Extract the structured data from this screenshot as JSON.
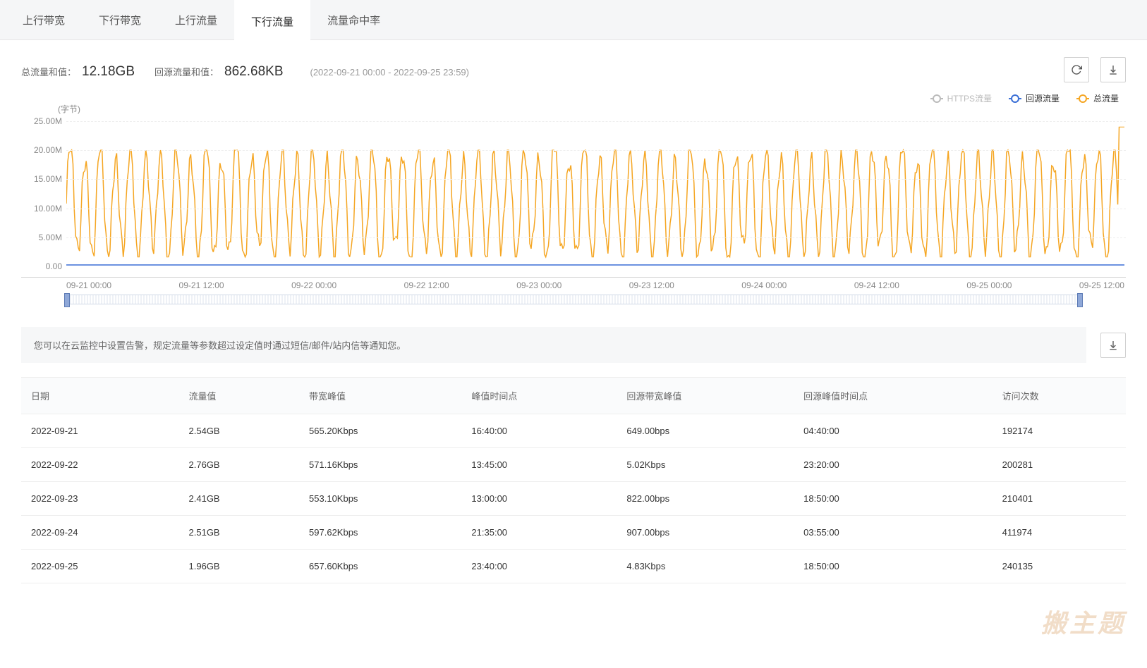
{
  "tabs": [
    "上行带宽",
    "下行带宽",
    "上行流量",
    "下行流量",
    "流量命中率"
  ],
  "active_tab": 3,
  "summary": {
    "total_label": "总流量和值：",
    "total_value": "12.18GB",
    "origin_label": "回源流量和值：",
    "origin_value": "862.68KB",
    "range": "(2022-09-21 00:00 - 2022-09-25 23:59)"
  },
  "legend": {
    "https": "HTTPS流量",
    "origin": "回源流量",
    "total": "总流量"
  },
  "chart_data": {
    "type": "line",
    "title": "",
    "ylabel": "(字节)",
    "ylim": [
      0,
      25
    ],
    "y_unit_suffix": "M",
    "y_ticks": [
      0.0,
      5.0,
      10.0,
      15.0,
      20.0,
      25.0
    ],
    "x_ticks": [
      "09-21 00:00",
      "09-21 12:00",
      "09-22 00:00",
      "09-22 12:00",
      "09-23 00:00",
      "09-23 12:00",
      "09-24 00:00",
      "09-24 12:00",
      "09-25 00:00",
      "09-25 12:00"
    ],
    "series": [
      {
        "name": "HTTPS流量",
        "color": "#bbbbbb",
        "visible": false,
        "values": []
      },
      {
        "name": "回源流量",
        "color": "#3b6fd6",
        "visible": true,
        "approx_constant": 0.0
      },
      {
        "name": "总流量",
        "color": "#f5a623",
        "visible": true,
        "note": "dense oscillation roughly between 1M and 20M across the full 5-day window; peaks ~20-22M, troughs ~1-2M, one final spike ~24M",
        "envelope_low": 1.5,
        "envelope_high": 20.0,
        "final_spike": 24.0
      }
    ]
  },
  "info_text": "您可以在云监控中设置告警，规定流量等参数超过设定值时通过短信/邮件/站内信等通知您。",
  "table": {
    "columns": [
      "日期",
      "流量值",
      "带宽峰值",
      "峰值时间点",
      "回源带宽峰值",
      "回源峰值时间点",
      "访问次数"
    ],
    "rows": [
      [
        "2022-09-21",
        "2.54GB",
        "565.20Kbps",
        "16:40:00",
        "649.00bps",
        "04:40:00",
        "192174"
      ],
      [
        "2022-09-22",
        "2.76GB",
        "571.16Kbps",
        "13:45:00",
        "5.02Kbps",
        "23:20:00",
        "200281"
      ],
      [
        "2022-09-23",
        "2.41GB",
        "553.10Kbps",
        "13:00:00",
        "822.00bps",
        "18:50:00",
        "210401"
      ],
      [
        "2022-09-24",
        "2.51GB",
        "597.62Kbps",
        "21:35:00",
        "907.00bps",
        "03:55:00",
        "411974"
      ],
      [
        "2022-09-25",
        "1.96GB",
        "657.60Kbps",
        "23:40:00",
        "4.83Kbps",
        "18:50:00",
        "240135"
      ]
    ]
  },
  "watermark": "搬主题"
}
